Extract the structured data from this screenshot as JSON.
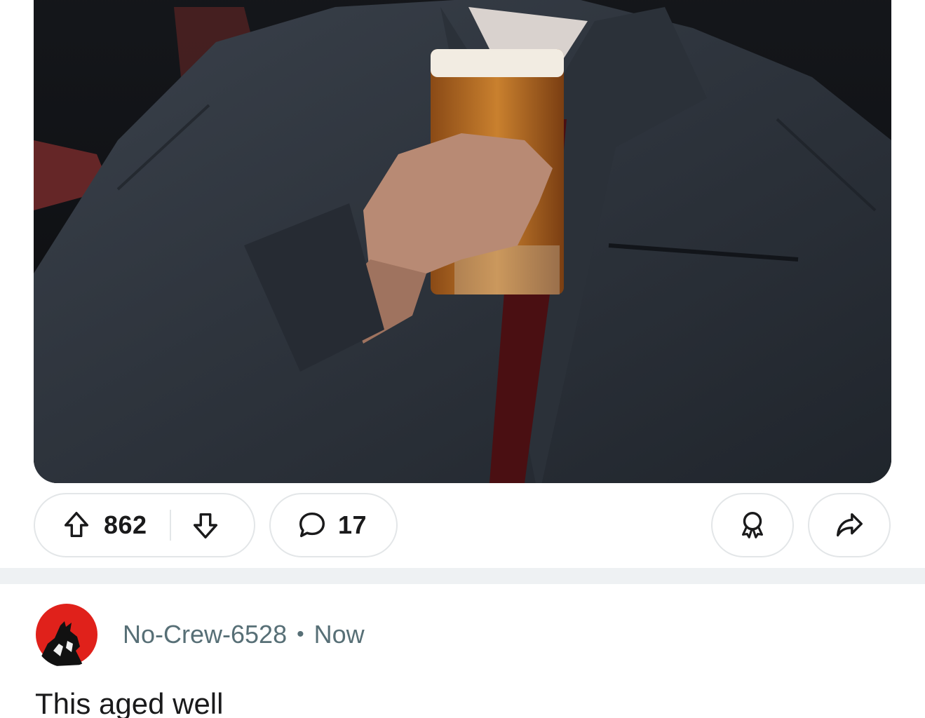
{
  "post": {
    "media": {
      "alt": "",
      "colors": {
        "background": "#0e1014",
        "jacket": "#2a3038",
        "beer": "#b36a22",
        "tie": "#4a0f12"
      }
    },
    "actions": {
      "upvote_icon": "arrow-up-icon",
      "vote_count": "862",
      "downvote_icon": "arrow-down-icon",
      "comment_icon": "comment-bubble-icon",
      "comment_count": "17",
      "award_icon": "award-icon",
      "share_icon": "share-icon"
    }
  },
  "comment": {
    "avatar_icon": "wolf-avatar-icon",
    "author": "No-Crew-6528",
    "separator": "•",
    "time": "Now",
    "body": "This aged well"
  },
  "colors": {
    "pill_border": "#e3e6e8",
    "meta_text": "#576f76",
    "band": "#eef1f3",
    "avatar_red": "#e0211b"
  }
}
